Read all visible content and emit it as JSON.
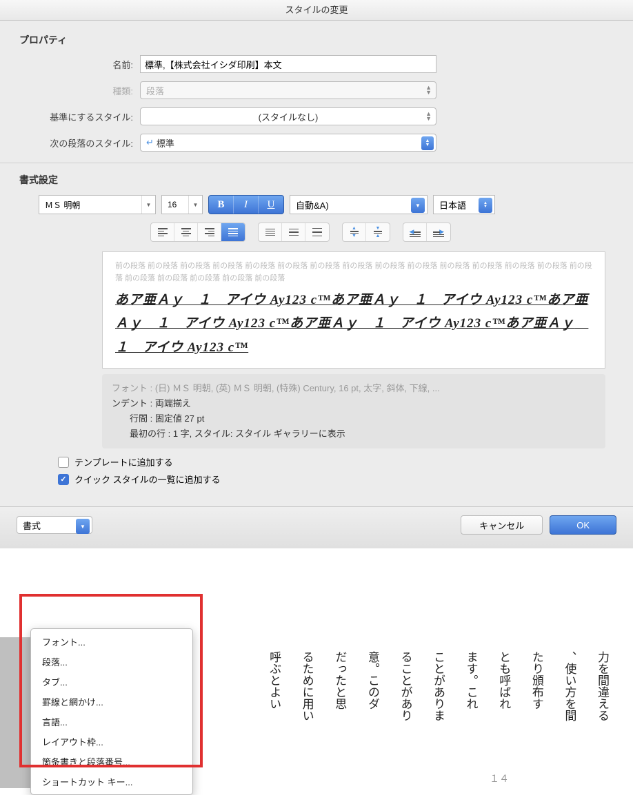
{
  "dialog": {
    "title": "スタイルの変更",
    "properties_heading": "プロパティ",
    "labels": {
      "name": "名前:",
      "type": "種類:",
      "based_on": "基準にするスタイル:",
      "next": "次の段落のスタイル:"
    },
    "name_value": "標準,【株式会社イシダ印刷】本文",
    "type_value": "段落",
    "based_on_value": "(スタイルなし)",
    "next_value": "標準",
    "formatting_heading": "書式設定",
    "font_name": "ＭＳ 明朝",
    "font_size": "16",
    "biu": {
      "b": "B",
      "i": "I",
      "u": "U"
    },
    "color_auto": "自動&A)",
    "lang": "日本語",
    "preview": {
      "before": "前の段落 前の段落 前の段落 前の段落 前の段落 前の段落 前の段落 前の段落 前の段落 前の段落 前の段落 前の段落 前の段落 前の段落 前の段落 前の段落 前の段落 前の段落 前の段落 前の段落",
      "sample": "あア亜Ａｙ　１　アイウ Ay123 c™あア亜Ａｙ　１　アイウ Ay123 c™あア亜Ａｙ　１　アイウ Ay123 c™あア亜Ａｙ　１　アイウ Ay123 c™あア亜Ａｙ　１　アイウ Ay123 c™"
    },
    "desc": {
      "line0": "フォント : (日) ＭＳ 明朝, (英) ＭＳ 明朝, (特殊) Century, 16 pt, 太字, 斜体, 下線, ...",
      "line1": "ンデント : 両端揃え",
      "line2": "行間 :  固定値 27 pt",
      "line3": "最初の行 :  1 字, スタイル: スタイル ギャラリーに表示"
    },
    "checks": {
      "add_template": "テンプレートに追加する",
      "add_quick": "クイック スタイルの一覧に追加する"
    },
    "format_button": "書式",
    "cancel": "キャンセル",
    "ok": "OK",
    "menu": [
      "フォント...",
      "段落...",
      "タブ...",
      "罫線と網かけ...",
      "言語...",
      "レイアウト枠...",
      "箇条書きと段落番号...",
      "ショートカット キー..."
    ]
  },
  "doc_cols": [
    "力を間違える",
    "、使い方を間",
    "たり頒布す",
    "とも呼ばれ",
    "ます。これ",
    "ことがありま",
    "ることがあり",
    "意。このダ",
    "だったと思",
    "るために用い",
    "呼ぶとよい"
  ],
  "page_num": "１４"
}
